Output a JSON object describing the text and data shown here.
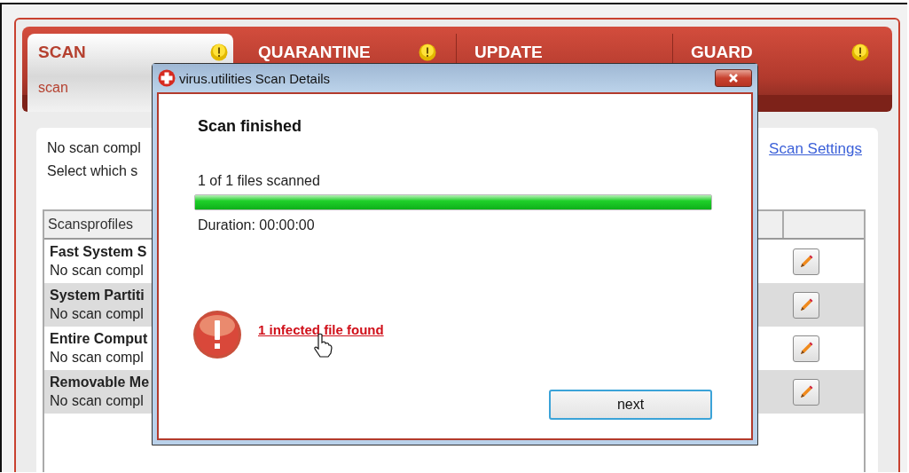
{
  "tabs": [
    {
      "label": "SCAN",
      "subtitle": "scan",
      "selected": true,
      "alert": true
    },
    {
      "label": "QUARANTINE",
      "selected": false,
      "alert": true
    },
    {
      "label": "UPDATE",
      "selected": false,
      "alert": false
    },
    {
      "label": "GUARD",
      "selected": false,
      "alert": true
    }
  ],
  "panel": {
    "status_line": "No scan compl",
    "instruction_line": "Select which s",
    "settings_link": "Scan Settings"
  },
  "table": {
    "columns": [
      "Scansprofiles"
    ],
    "rows": [
      {
        "name": "Fast System S",
        "status": "No scan compl"
      },
      {
        "name": "System Partiti",
        "status": "No scan compl"
      },
      {
        "name": "Entire Comput",
        "status": "No scan compl"
      },
      {
        "name": "Removable Me",
        "status": "No scan compl"
      }
    ]
  },
  "dialog": {
    "title": "virus.utilities Scan Details",
    "heading": "Scan finished",
    "progress_text": "1 of 1 files scanned",
    "progress": {
      "level": 1
    },
    "duration": "Duration: 00:00:00",
    "result_link": "1 infected file found",
    "button": "next"
  }
}
